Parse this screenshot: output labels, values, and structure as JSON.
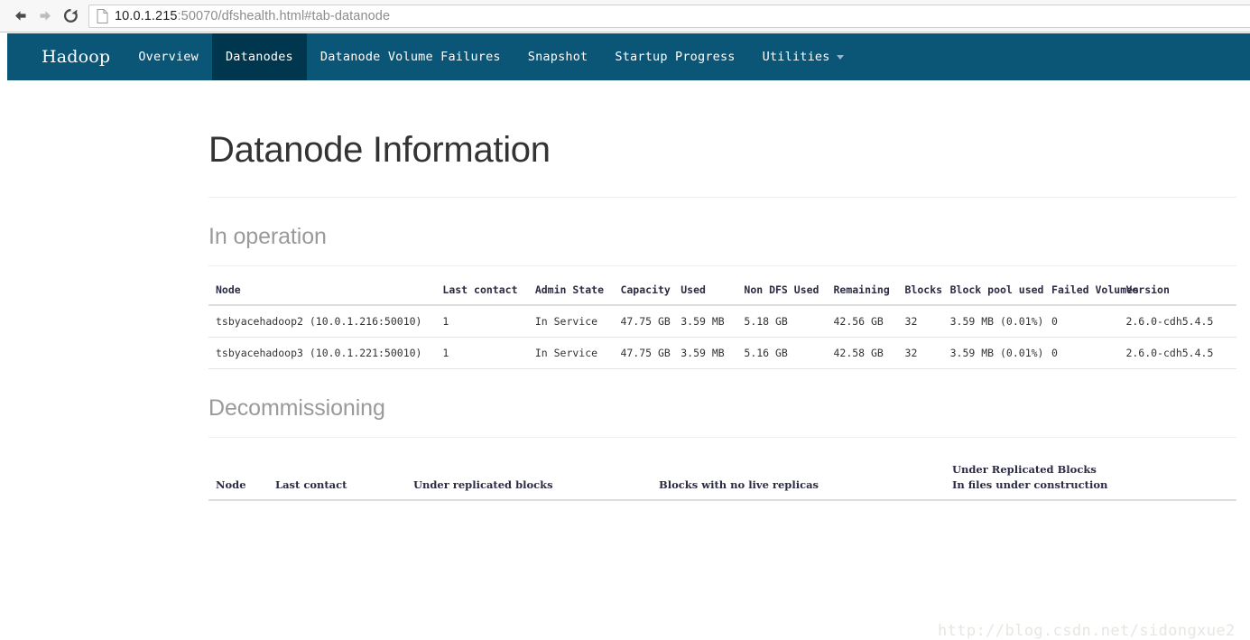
{
  "browser": {
    "back_icon": "back-arrow-icon",
    "forward_icon": "forward-arrow-icon",
    "reload_icon": "reload-icon",
    "page_icon": "page-document-icon",
    "url_host": "10.0.1.215",
    "url_rest": ":50070/dfshealth.html#tab-datanode",
    "url_full": "10.0.1.215:50070/dfshealth.html#tab-datanode"
  },
  "navbar": {
    "brand": "Hadoop",
    "background_color": "#0b5577",
    "active_color": "#00374f",
    "items": [
      {
        "label": "Overview",
        "active": false
      },
      {
        "label": "Datanodes",
        "active": true
      },
      {
        "label": "Datanode Volume Failures",
        "active": false
      },
      {
        "label": "Snapshot",
        "active": false
      },
      {
        "label": "Startup Progress",
        "active": false
      },
      {
        "label": "Utilities",
        "active": false,
        "has_caret": true
      }
    ]
  },
  "page": {
    "title": "Datanode Information"
  },
  "in_operation": {
    "heading": "In operation",
    "columns": [
      "Node",
      "Last contact",
      "Admin State",
      "Capacity",
      "Used",
      "Non DFS Used",
      "Remaining",
      "Blocks",
      "Block pool used",
      "Failed Volumes",
      "Version"
    ],
    "rows": [
      {
        "node": "tsbyacehadoop2 (10.0.1.216:50010)",
        "last_contact": "1",
        "admin_state": "In Service",
        "capacity": "47.75 GB",
        "used": "3.59 MB",
        "non_dfs_used": "5.18 GB",
        "remaining": "42.56 GB",
        "blocks": "32",
        "block_pool_used": "3.59 MB (0.01%)",
        "failed_volumes": "0",
        "version": "2.6.0-cdh5.4.5"
      },
      {
        "node": "tsbyacehadoop3 (10.0.1.221:50010)",
        "last_contact": "1",
        "admin_state": "In Service",
        "capacity": "47.75 GB",
        "used": "3.59 MB",
        "non_dfs_used": "5.16 GB",
        "remaining": "42.58 GB",
        "blocks": "32",
        "block_pool_used": "3.59 MB (0.01%)",
        "failed_volumes": "0",
        "version": "2.6.0-cdh5.4.5"
      }
    ]
  },
  "decommissioning": {
    "heading": "Decommissioning",
    "columns": {
      "node": "Node",
      "last_contact": "Last contact",
      "under_replicated_blocks": "Under replicated blocks",
      "blocks_no_live_replicas": "Blocks with no live replicas",
      "under_replicated_line1": "Under Replicated Blocks",
      "under_replicated_line2": "In files under construction"
    },
    "rows": []
  },
  "watermark": "http://blog.csdn.net/sidongxue2"
}
